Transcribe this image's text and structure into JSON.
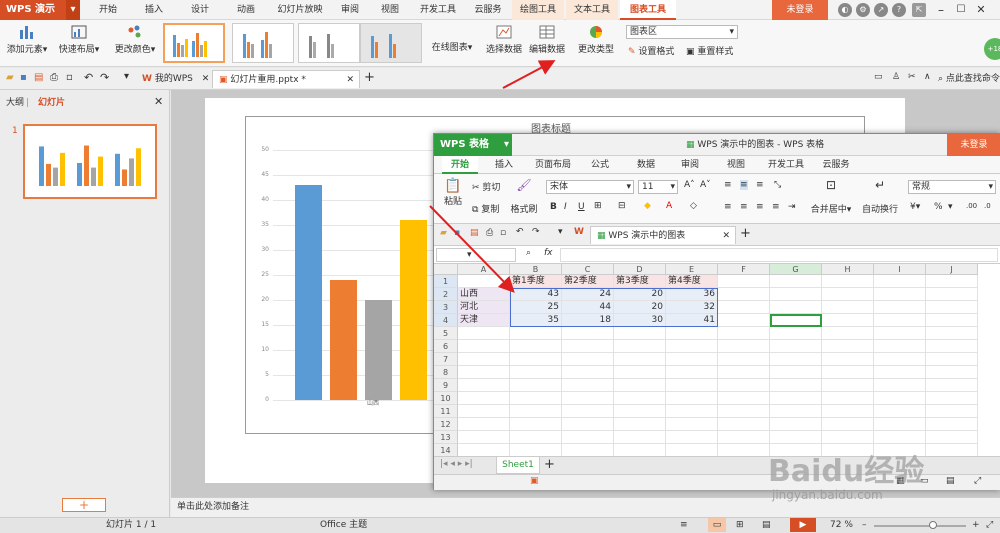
{
  "app": {
    "name": "WPS 演示",
    "login": "未登录"
  },
  "menu": [
    "开始",
    "插入",
    "设计",
    "动画",
    "幻灯片放映",
    "审阅",
    "视图",
    "开发工具",
    "云服务",
    "绘图工具",
    "文本工具",
    "图表工具"
  ],
  "ribbon": {
    "add_element": "添加元素",
    "quick_layout": "快速布局",
    "change_color": "更改颜色",
    "online_chart": "在线图表",
    "select_data": "选择数据",
    "edit_data": "编辑数据",
    "change_type": "更改类型",
    "chart_area": "图表区",
    "set_format": "设置格式",
    "reset_style": "重置样式"
  },
  "doctabs": {
    "my_wps": "我的WPS",
    "file": "幻灯片重用.pptx *",
    "search_cmd": "点此查找命令"
  },
  "left_panel": {
    "outline": "大纲",
    "slides": "幻灯片",
    "slide_num": "1"
  },
  "slide": {
    "chart_title": "图表标题",
    "category_label": "山西",
    "yticks": [
      "50",
      "45",
      "40",
      "35",
      "30",
      "25",
      "20",
      "15",
      "10",
      "5",
      "0"
    ]
  },
  "chart_data": {
    "type": "bar",
    "title": "图表标题",
    "categories": [
      "山西",
      "河北",
      "天津"
    ],
    "series": [
      {
        "name": "第1季度",
        "values": [
          43,
          25,
          35
        ]
      },
      {
        "name": "第2季度",
        "values": [
          24,
          44,
          18
        ]
      },
      {
        "name": "第3季度",
        "values": [
          20,
          20,
          30
        ]
      },
      {
        "name": "第4季度",
        "values": [
          36,
          32,
          41
        ]
      }
    ],
    "ylim": [
      0,
      50
    ],
    "colors": [
      "#5b9bd5",
      "#ed7d31",
      "#a5a5a5",
      "#ffc000"
    ]
  },
  "notes_placeholder": "单击此处添加备注",
  "status": {
    "slide_info": "幻灯片 1 / 1",
    "theme": "Office 主题",
    "zoom": "72 %"
  },
  "spreadsheet": {
    "app": "WPS 表格",
    "title": "WPS 演示中的图表 - WPS 表格",
    "login": "未登录",
    "menu": [
      "开始",
      "插入",
      "页面布局",
      "公式",
      "数据",
      "审阅",
      "视图",
      "开发工具",
      "云服务"
    ],
    "ribbon": {
      "paste": "粘贴",
      "cut": "剪切",
      "copy": "复制",
      "format_painter": "格式刷",
      "font": "宋体",
      "font_size": "11",
      "merge_center": "合并居中",
      "wrap": "自动换行",
      "number_format": "常规",
      "percent": "%"
    },
    "doctab": "WPS 演示中的图表",
    "fx": "fx",
    "cols": [
      "A",
      "B",
      "C",
      "D",
      "E",
      "F",
      "G",
      "H",
      "I",
      "J"
    ],
    "rows": [
      "1",
      "2",
      "3",
      "4",
      "5",
      "6",
      "7",
      "8",
      "9",
      "10",
      "11",
      "12",
      "13",
      "14"
    ],
    "header_row": [
      "",
      "第1季度",
      "第2季度",
      "第3季度",
      "第4季度"
    ],
    "data_rows": [
      [
        "山西",
        "43",
        "24",
        "20",
        "36"
      ],
      [
        "河北",
        "25",
        "44",
        "20",
        "32"
      ],
      [
        "天津",
        "35",
        "18",
        "30",
        "41"
      ]
    ],
    "sheet_tab": "Sheet1"
  },
  "watermark": {
    "brand": "Baidu经验",
    "url": "jingyan.baidu.com"
  }
}
